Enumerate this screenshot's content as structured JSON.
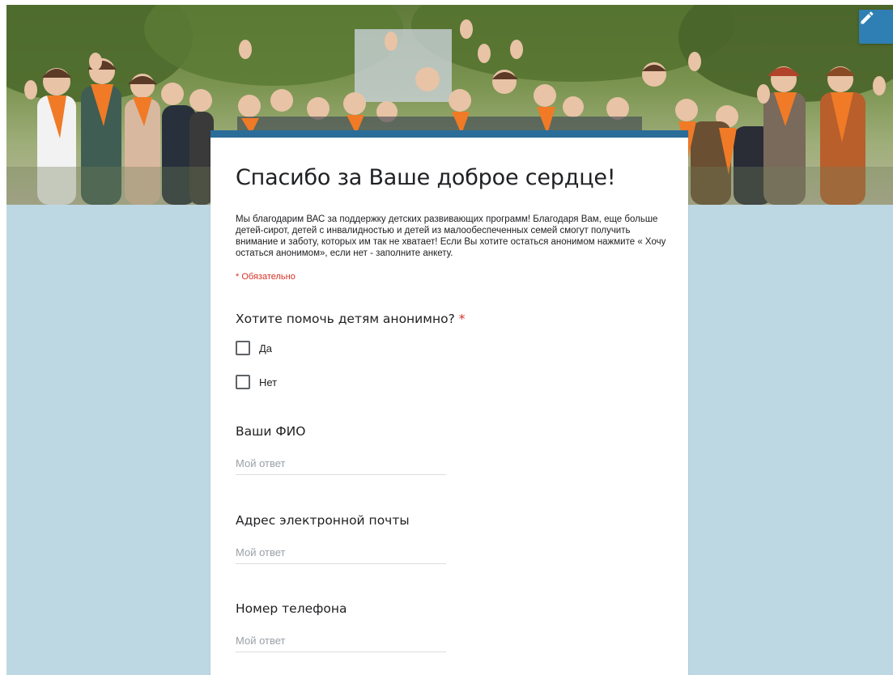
{
  "header": {
    "edit_icon": "pencil-icon"
  },
  "form": {
    "title": "Спасибо за Ваше доброе сердце!",
    "description": "Мы благодарим ВАС за поддержку детских развивающих программ! Благодаря Вам, еще больше детей-сирот, детей с инвалидностью и детей из малообеспеченных семей смогут получить внимание и заботу, которых им так не хватает! Если Вы хотите остаться анонимом нажмите « Хочу остаться анонимом», если нет - заполните анкету.",
    "required_note": "* Обязательно"
  },
  "questions": {
    "anonymous": {
      "title": "Хотите помочь детям анонимно?",
      "required_mark": "*",
      "options": [
        "Да",
        "Нет"
      ]
    },
    "full_name": {
      "title": "Ваши ФИО",
      "placeholder": "Мой ответ"
    },
    "email": {
      "title": "Адрес электронной почты",
      "placeholder": "Мой ответ"
    },
    "phone": {
      "title": "Номер телефона",
      "placeholder": "Мой ответ"
    }
  },
  "colors": {
    "background": "#bed8e3",
    "theme": "#2a6d99",
    "edit_button": "#2f7fb4",
    "required": "#d93025"
  }
}
